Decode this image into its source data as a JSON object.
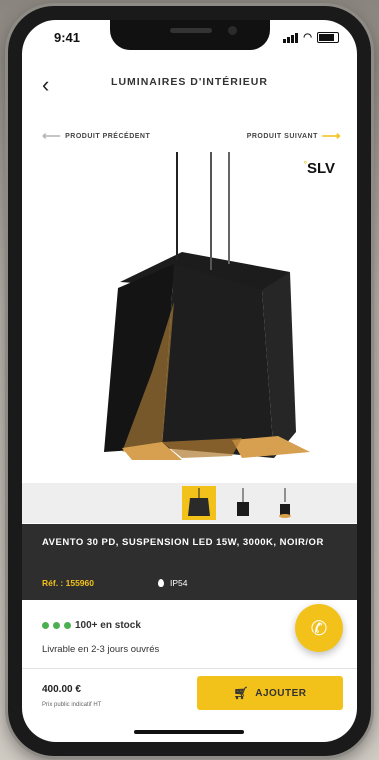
{
  "status": {
    "time": "9:41"
  },
  "header": {
    "back_icon": "‹",
    "title": "LUMINAIRES D'INTÉRIEUR"
  },
  "nav": {
    "prev_label": "PRODUIT PRÉCÉDENT",
    "next_label": "PRODUIT SUIVANT"
  },
  "brand": {
    "name": "SLV"
  },
  "product": {
    "name": "AVENTO 30 PD, SUSPENSION LED 15W, 3000K, NOIR/OR",
    "ref": "Réf. : 155960",
    "ip": "IP54"
  },
  "availability": {
    "stock": "100+ en stock",
    "delivery": "Livrable en 2-3 jours ouvrés"
  },
  "purchase": {
    "price": "400.00 €",
    "price_note": "Prix public indicatif HT",
    "add_label": "AJOUTER"
  },
  "colors": {
    "accent": "#f2c21b",
    "info_bar": "#2e2e2e",
    "stock_dot": "#4caf50"
  },
  "icons": [
    "back-chevron-icon",
    "arrow-left-icon",
    "arrow-right-icon",
    "water-drop-icon",
    "phone-icon",
    "cart-icon"
  ]
}
